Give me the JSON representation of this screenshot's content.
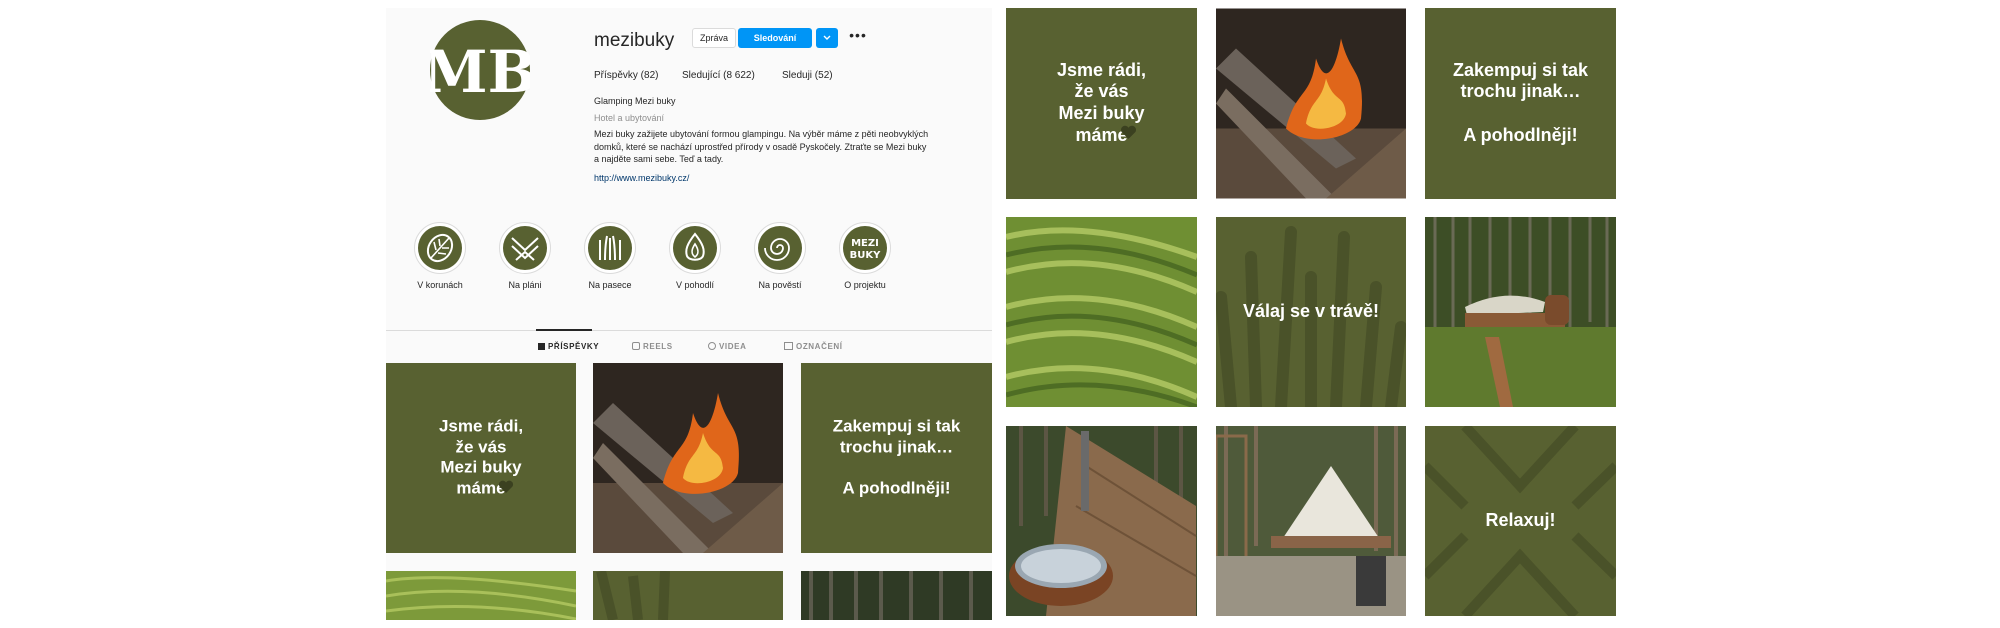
{
  "profile": {
    "logo_text": "MB",
    "username": "mezibuky",
    "buttons": {
      "message": "Zpráva",
      "follow": "Sledování",
      "dropdown": "⌄",
      "more": "•••"
    },
    "stats": {
      "posts": "Příspěvky (82)",
      "followers": "Sledující (8 622)",
      "following": "Sleduji (52)"
    },
    "bio": {
      "name": "Glamping Mezi buky",
      "category": "Hotel a ubytování",
      "description_line1": "Mezi buky zažijete ubytování formou glampingu. Na výběr máme z pěti neobvyklých",
      "description_line2": "domků, které se nachází uprostřed přírody v osadě Pyskočely. Ztraťte se Mezi buky",
      "description_line3": "a najděte sami sebe. Teď a tady.",
      "link": "http://www.mezibuky.cz/"
    }
  },
  "highlights": [
    {
      "label": "V korunách",
      "icon": "leaf-icon"
    },
    {
      "label": "Na pláni",
      "icon": "chevron-pattern-icon"
    },
    {
      "label": "Na pasece",
      "icon": "grass-icon"
    },
    {
      "label": "V pohodlí",
      "icon": "flame-icon"
    },
    {
      "label": "Na pověstí",
      "icon": "swirl-icon"
    },
    {
      "label": "O projektu",
      "icon": "mezibuky-logo-icon",
      "logo_text_1": "MEZI",
      "logo_text_2": "BUKY"
    }
  ],
  "tabs": [
    {
      "label": "PŘÍSPĚVKY",
      "icon": "grid-icon",
      "active": true
    },
    {
      "label": "REELS",
      "icon": "reels-icon",
      "active": false
    },
    {
      "label": "VIDEA",
      "icon": "video-icon",
      "active": false
    },
    {
      "label": "OZNAČENÍ",
      "icon": "tag-icon",
      "active": false
    }
  ],
  "posts": {
    "welcome": "Jsme rádi,\nže vás\nMezi buky\nmáme",
    "camping": "Zakempuj si tak\ntrochu jinak…\n\nA pohodlněji!",
    "grass": "Válaj se v trávě!",
    "relax": "Relaxuj!"
  },
  "colors": {
    "brand": "#586131",
    "follow_blue": "#0095f6",
    "link": "#00376b"
  }
}
